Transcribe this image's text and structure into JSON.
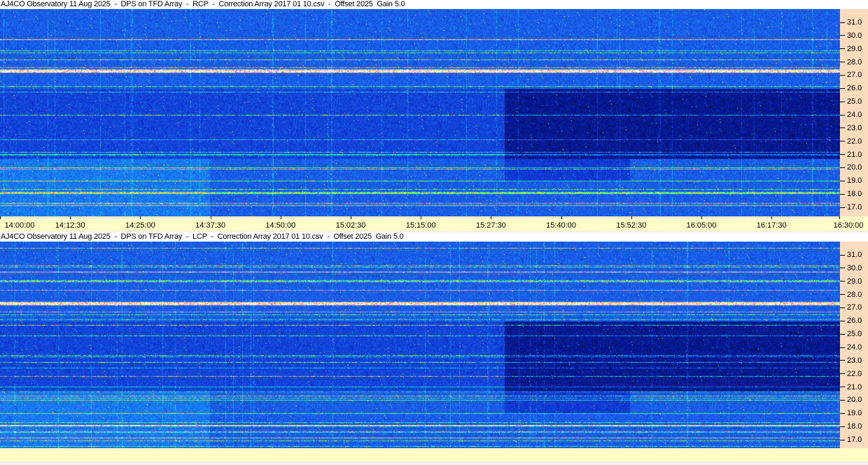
{
  "panels": [
    {
      "title": "AJ4CO Observatory 11 Aug 2025  -  DPS on TFD Array  -  RCP  -  Correction Array 2017 01 10.csv  -  Offset 2025  Gain 5.0",
      "polarization": "RCP"
    },
    {
      "title": "AJ4CO Observatory 11 Aug 2025  -  DPS on TFD Array  -  LCP  -  Correction Array 2017 01 10.csv  -  Offset 2025  Gain 5.0",
      "polarization": "LCP"
    }
  ],
  "freq_labels": [
    "31.0",
    "30.0",
    "29.0",
    "28.0",
    "27.0",
    "26.0",
    "25.0",
    "24.0",
    "23.0",
    "22.0",
    "21.0",
    "20.0",
    "19.0",
    "18.0",
    "17.0"
  ],
  "time_labels": [
    "14:00:00",
    "14:12:30",
    "14:25:00",
    "14:37:30",
    "14:50:00",
    "15:02:30",
    "15:15:00",
    "15:27:30",
    "15:40:00",
    "15:52:30",
    "16:05:00",
    "16:17:30",
    "16:30:00"
  ],
  "colors": {
    "axis_right": "#fddcbe",
    "axis_bottom": "#fffcc8"
  }
}
